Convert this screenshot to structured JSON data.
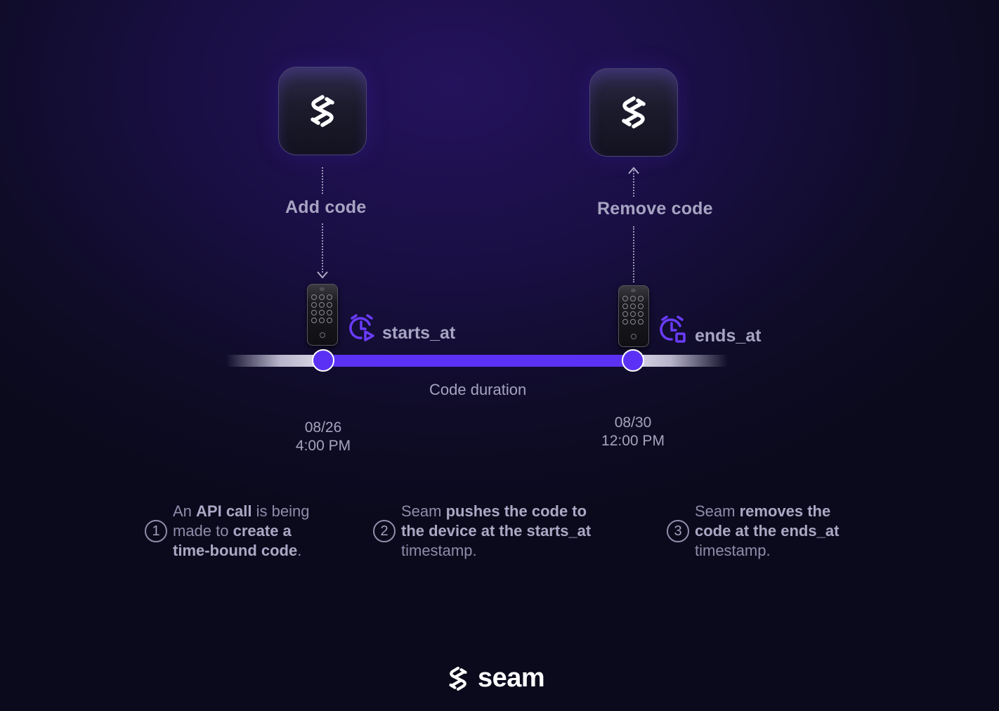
{
  "diagram": {
    "steps_top": {
      "add": {
        "label": "Add code",
        "icon": "seam-logo-icon"
      },
      "remove": {
        "label": "Remove code",
        "icon": "seam-logo-icon"
      }
    },
    "timeline": {
      "start_label": "starts_at",
      "end_label": "ends_at",
      "duration_label": "Code duration",
      "start_date": "08/26",
      "start_time": "4:00 PM",
      "end_date": "08/30",
      "end_time": "12:00 PM",
      "accent_color": "#5b32f5"
    },
    "explanations": [
      {
        "number": "1",
        "parts": [
          {
            "t": "An ",
            "b": false
          },
          {
            "t": "API call",
            "b": true
          },
          {
            "t": " is being made to ",
            "b": false
          },
          {
            "t": "create a time-bound code",
            "b": true
          },
          {
            "t": ".",
            "b": false
          }
        ]
      },
      {
        "number": "2",
        "parts": [
          {
            "t": "Seam ",
            "b": false
          },
          {
            "t": "pushes the code to the device at the starts_at",
            "b": true
          },
          {
            "t": " timestamp.",
            "b": false
          }
        ]
      },
      {
        "number": "3",
        "parts": [
          {
            "t": "Seam ",
            "b": false
          },
          {
            "t": "removes the code at the ends_at",
            "b": true
          },
          {
            "t": " timestamp.",
            "b": false
          }
        ]
      }
    ]
  },
  "footer": {
    "brand": "seam"
  }
}
